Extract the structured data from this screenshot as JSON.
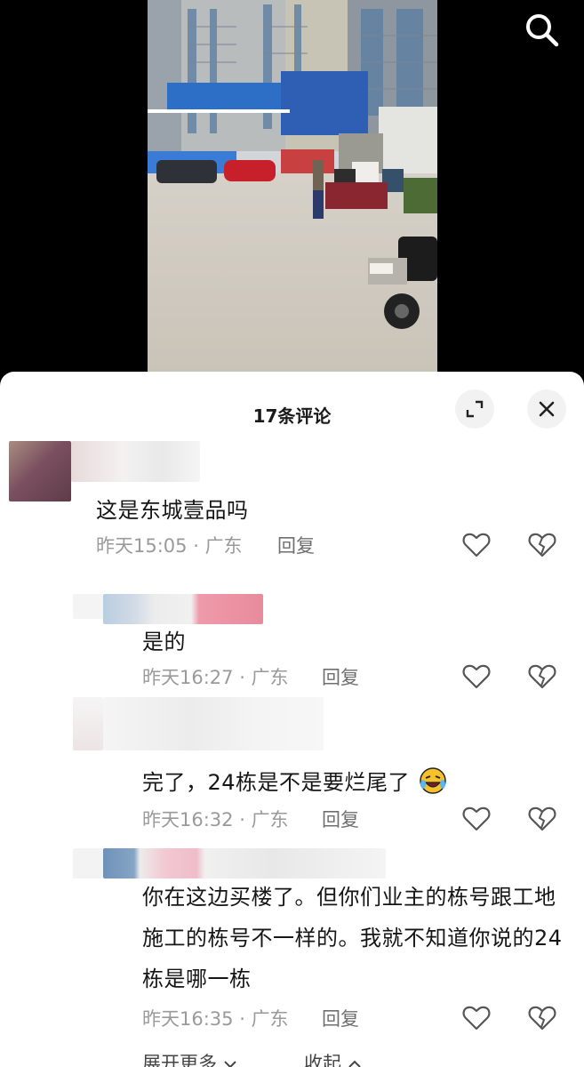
{
  "sheet": {
    "title": "17条评论"
  },
  "comments": [
    {
      "text": "这是东城壹品吗",
      "time": "昨天15:05",
      "location": "广东",
      "reply_label": "回复"
    },
    {
      "text": "是的",
      "time": "昨天16:27",
      "location": "广东",
      "reply_label": "回复"
    },
    {
      "text": "完了，24栋是不是要烂尾了",
      "time": "昨天16:32",
      "location": "广东",
      "reply_label": "回复"
    },
    {
      "text": "你在这边买楼了。但你们业主的栋号跟工地施工的栋号不一样的。我就不知道你说的24栋是哪一栋",
      "time": "昨天16:35",
      "location": "广东",
      "reply_label": "回复"
    }
  ],
  "footer": {
    "expand_more": "展开更多",
    "collapse": "收起"
  },
  "icons": {
    "search": "search-icon",
    "expand": "expand-icon",
    "close": "close-icon",
    "like": "heart-icon",
    "dislike": "broken-heart-icon",
    "emoji": "crying-laughing-emoji"
  },
  "colors": {
    "sheet_bg": "#ffffff",
    "meta_text": "#9a9a9a",
    "button_bg": "#f2f2f2"
  }
}
